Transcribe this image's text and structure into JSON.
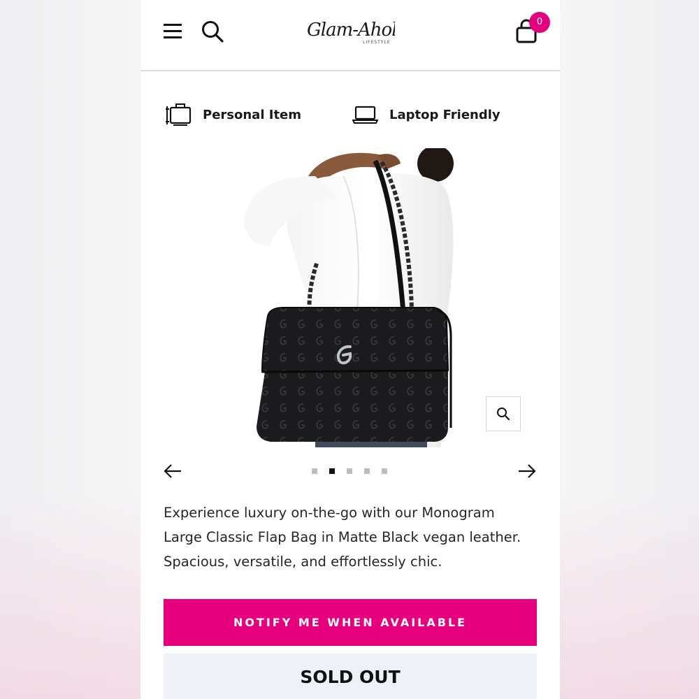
{
  "header": {
    "logo_text": "Glam-Aholic",
    "logo_subtext": "LIFESTYLE",
    "cart_count": "0",
    "brand_color": "#e6007e",
    "icons": [
      "menu-icon",
      "search-icon",
      "shopping-bag-icon"
    ]
  },
  "features": [
    {
      "label": "Personal Item",
      "icon": "personal-item-icon"
    },
    {
      "label": "Laptop Friendly",
      "icon": "laptop-icon"
    }
  ],
  "gallery": {
    "slide_count": 5,
    "active_slide": 2,
    "icons": [
      "zoom-icon",
      "arrow-left-icon",
      "arrow-right-icon"
    ]
  },
  "product": {
    "description": "Experience luxury on-the-go with our Monogram Large Classic Flap Bag in Matte Black vegan leather. Spacious, versatile, and effortlessly chic."
  },
  "actions": {
    "notify_label": "NOTIFY ME WHEN AVAILABLE",
    "sold_out_label": "SOLD OUT"
  }
}
